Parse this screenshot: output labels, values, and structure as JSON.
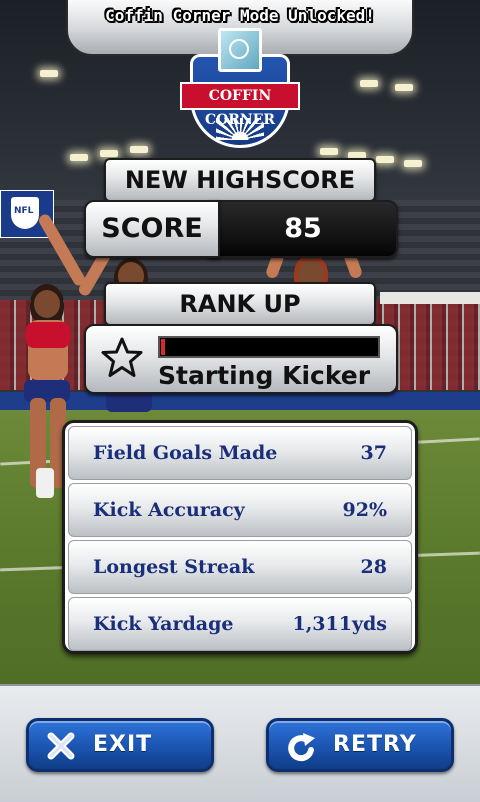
{
  "banner": {
    "text": "Coffin Corner Mode Unlocked!"
  },
  "badge": {
    "label": "COFFIN CORNER"
  },
  "highscore": {
    "title": "NEW HIGHSCORE",
    "score_label": "SCORE",
    "score_value": "85"
  },
  "rank": {
    "title": "RANK UP",
    "name": "Starting Kicker",
    "progress": 0.01,
    "icon": "star-icon"
  },
  "stats": [
    {
      "label": "Field Goals Made",
      "value": "37"
    },
    {
      "label": "Kick Accuracy",
      "value": "92%"
    },
    {
      "label": "Longest Streak",
      "value": "28"
    },
    {
      "label": "Kick Yardage",
      "value": "1,311yds"
    }
  ],
  "buttons": {
    "exit": {
      "label": "EXIT",
      "icon": "close-icon"
    },
    "retry": {
      "label": "RETRY",
      "icon": "retry-icon"
    }
  },
  "colors": {
    "stat_text": "#1a2f7a",
    "button_blue": "#1d57b5",
    "progress_red": "#d8282c"
  }
}
